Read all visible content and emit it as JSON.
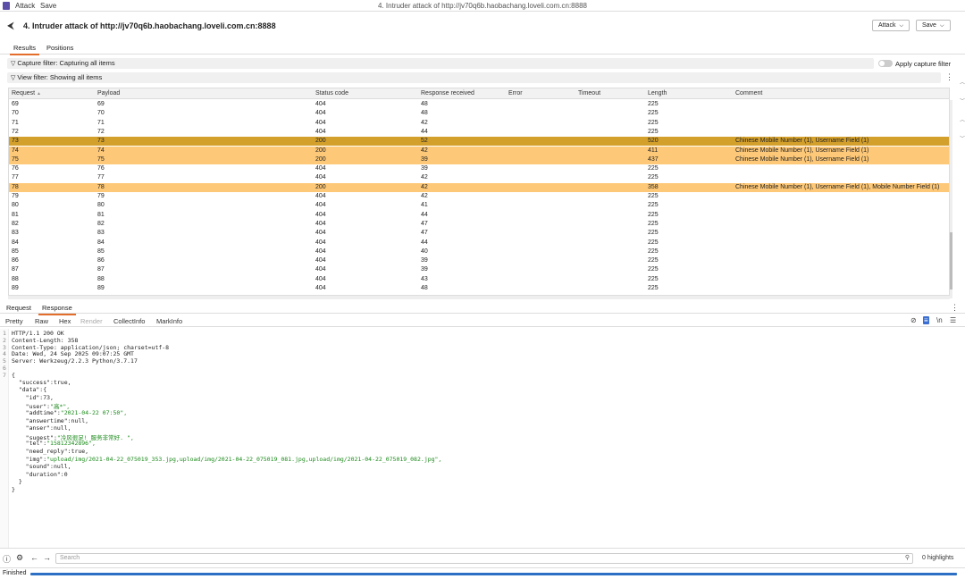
{
  "menubar": {
    "menu1": "Attack",
    "menu2": "Save",
    "window_title": "4. Intruder attack of http://jv70q6b.haobachang.loveli.com.cn:8888"
  },
  "header": {
    "title": "4. Intruder attack of http://jv70q6b.haobachang.loveli.com.cn:8888",
    "attack_button": "Attack",
    "save_button": "Save"
  },
  "tabs": [
    "Results",
    "Positions"
  ],
  "capture_filter": "Capture filter: Capturing all items",
  "apply_capture_filter": "Apply capture filter",
  "view_filter": "View filter: Showing all items",
  "table": {
    "columns": [
      "Request",
      "Payload",
      "Status code",
      "Response received",
      "Error",
      "Timeout",
      "Length",
      "Comment"
    ],
    "sort_indicator": "▲",
    "rows": [
      {
        "request": "69",
        "payload": "69",
        "status": "404",
        "received": "48",
        "error": "",
        "timeout": "",
        "length": "225",
        "comment": "",
        "hl": ""
      },
      {
        "request": "70",
        "payload": "70",
        "status": "404",
        "received": "48",
        "error": "",
        "timeout": "",
        "length": "225",
        "comment": "",
        "hl": ""
      },
      {
        "request": "71",
        "payload": "71",
        "status": "404",
        "received": "42",
        "error": "",
        "timeout": "",
        "length": "225",
        "comment": "",
        "hl": ""
      },
      {
        "request": "72",
        "payload": "72",
        "status": "404",
        "received": "44",
        "error": "",
        "timeout": "",
        "length": "225",
        "comment": "",
        "hl": ""
      },
      {
        "request": "73",
        "payload": "73",
        "status": "200",
        "received": "52",
        "error": "",
        "timeout": "",
        "length": "520",
        "comment": "Chinese Mobile Number (1), Username Field (1)",
        "hl": "selected"
      },
      {
        "request": "74",
        "payload": "74",
        "status": "200",
        "received": "42",
        "error": "",
        "timeout": "",
        "length": "411",
        "comment": "Chinese Mobile Number (1), Username Field (1)",
        "hl": "orange"
      },
      {
        "request": "75",
        "payload": "75",
        "status": "200",
        "received": "39",
        "error": "",
        "timeout": "",
        "length": "437",
        "comment": "Chinese Mobile Number (1), Username Field (1)",
        "hl": "orange"
      },
      {
        "request": "76",
        "payload": "76",
        "status": "404",
        "received": "39",
        "error": "",
        "timeout": "",
        "length": "225",
        "comment": "",
        "hl": ""
      },
      {
        "request": "77",
        "payload": "77",
        "status": "404",
        "received": "42",
        "error": "",
        "timeout": "",
        "length": "225",
        "comment": "",
        "hl": ""
      },
      {
        "request": "78",
        "payload": "78",
        "status": "200",
        "received": "42",
        "error": "",
        "timeout": "",
        "length": "358",
        "comment": "Chinese Mobile Number (1), Username Field (1), Mobile Number Field (1)",
        "hl": "orange"
      },
      {
        "request": "79",
        "payload": "79",
        "status": "404",
        "received": "42",
        "error": "",
        "timeout": "",
        "length": "225",
        "comment": "",
        "hl": ""
      },
      {
        "request": "80",
        "payload": "80",
        "status": "404",
        "received": "41",
        "error": "",
        "timeout": "",
        "length": "225",
        "comment": "",
        "hl": ""
      },
      {
        "request": "81",
        "payload": "81",
        "status": "404",
        "received": "44",
        "error": "",
        "timeout": "",
        "length": "225",
        "comment": "",
        "hl": ""
      },
      {
        "request": "82",
        "payload": "82",
        "status": "404",
        "received": "47",
        "error": "",
        "timeout": "",
        "length": "225",
        "comment": "",
        "hl": ""
      },
      {
        "request": "83",
        "payload": "83",
        "status": "404",
        "received": "47",
        "error": "",
        "timeout": "",
        "length": "225",
        "comment": "",
        "hl": ""
      },
      {
        "request": "84",
        "payload": "84",
        "status": "404",
        "received": "44",
        "error": "",
        "timeout": "",
        "length": "225",
        "comment": "",
        "hl": ""
      },
      {
        "request": "85",
        "payload": "85",
        "status": "404",
        "received": "40",
        "error": "",
        "timeout": "",
        "length": "225",
        "comment": "",
        "hl": ""
      },
      {
        "request": "86",
        "payload": "86",
        "status": "404",
        "received": "39",
        "error": "",
        "timeout": "",
        "length": "225",
        "comment": "",
        "hl": ""
      },
      {
        "request": "87",
        "payload": "87",
        "status": "404",
        "received": "39",
        "error": "",
        "timeout": "",
        "length": "225",
        "comment": "",
        "hl": ""
      },
      {
        "request": "88",
        "payload": "88",
        "status": "404",
        "received": "43",
        "error": "",
        "timeout": "",
        "length": "225",
        "comment": "",
        "hl": ""
      },
      {
        "request": "89",
        "payload": "89",
        "status": "404",
        "received": "48",
        "error": "",
        "timeout": "",
        "length": "225",
        "comment": "",
        "hl": ""
      }
    ]
  },
  "reqres_tabs": [
    "Request",
    "Response"
  ],
  "viewer_tabs": [
    "Pretty",
    "Raw",
    "Hex",
    "Render",
    "CollectInfo",
    "MarkInfo"
  ],
  "response_lines": [
    "HTTP/1.1 200 OK",
    "Content-Length: 358",
    "Content-Type: application/json; charset=utf-8",
    "Date: Wed, 24 Sep 2025 09:07:25 GMT",
    "Server: Werkzeug/2.2.3 Python/3.7.17",
    "",
    "{"
  ],
  "json_body": [
    {
      "k": "  \"success\":",
      "v": "true,",
      "str": false
    },
    {
      "k": "  \"data\":{",
      "v": "",
      "str": false
    },
    {
      "k": "    \"id\":",
      "v": "73,",
      "str": false
    },
    {
      "k": "    \"user\":",
      "v": "\"高*\",",
      "str": true
    },
    {
      "k": "    \"addtime\":",
      "v": "\"2021-04-22 07:50\",",
      "str": true
    },
    {
      "k": "    \"answertime\":",
      "v": "null,",
      "str": false
    },
    {
      "k": "    \"anser\":",
      "v": "null,",
      "str": false
    },
    {
      "k": "    \"sugest\":",
      "v": "\"冷风很足! 服务非常好. \",",
      "str": true
    },
    {
      "k": "    \"tel\":",
      "v": "\"15812342896\",",
      "str": true
    },
    {
      "k": "    \"need_reply\":",
      "v": "true,",
      "str": false
    },
    {
      "k": "    \"img\":",
      "v": "\"upload/img/2021-04-22_075019_353.jpg,upload/img/2021-04-22_075019_081.jpg,upload/img/2021-04-22_075019_082.jpg\",",
      "str": true
    },
    {
      "k": "    \"sound\":",
      "v": "null,",
      "str": false
    },
    {
      "k": "    \"duration\":",
      "v": "0",
      "str": false
    },
    {
      "k": "  }",
      "v": "",
      "str": false
    },
    {
      "k": "}",
      "v": "",
      "str": false
    }
  ],
  "search": {
    "placeholder": "Search",
    "highlights": "0 highlights"
  },
  "status": {
    "text": "Finished",
    "progress": 1.0
  },
  "colors": {
    "selected_row": "#d4a02c",
    "highlight_row": "#fdc877",
    "accent": "#e36d2b",
    "progress": "#2d6fc4"
  },
  "icons": {
    "back": "back-arrow-icon",
    "help": "help-icon",
    "settings": "gear-icon",
    "prev": "left-arrow-icon",
    "next": "right-arrow-icon",
    "search": "search-icon",
    "kebab": "kebab-menu-icon",
    "funnel": "filter-icon"
  }
}
